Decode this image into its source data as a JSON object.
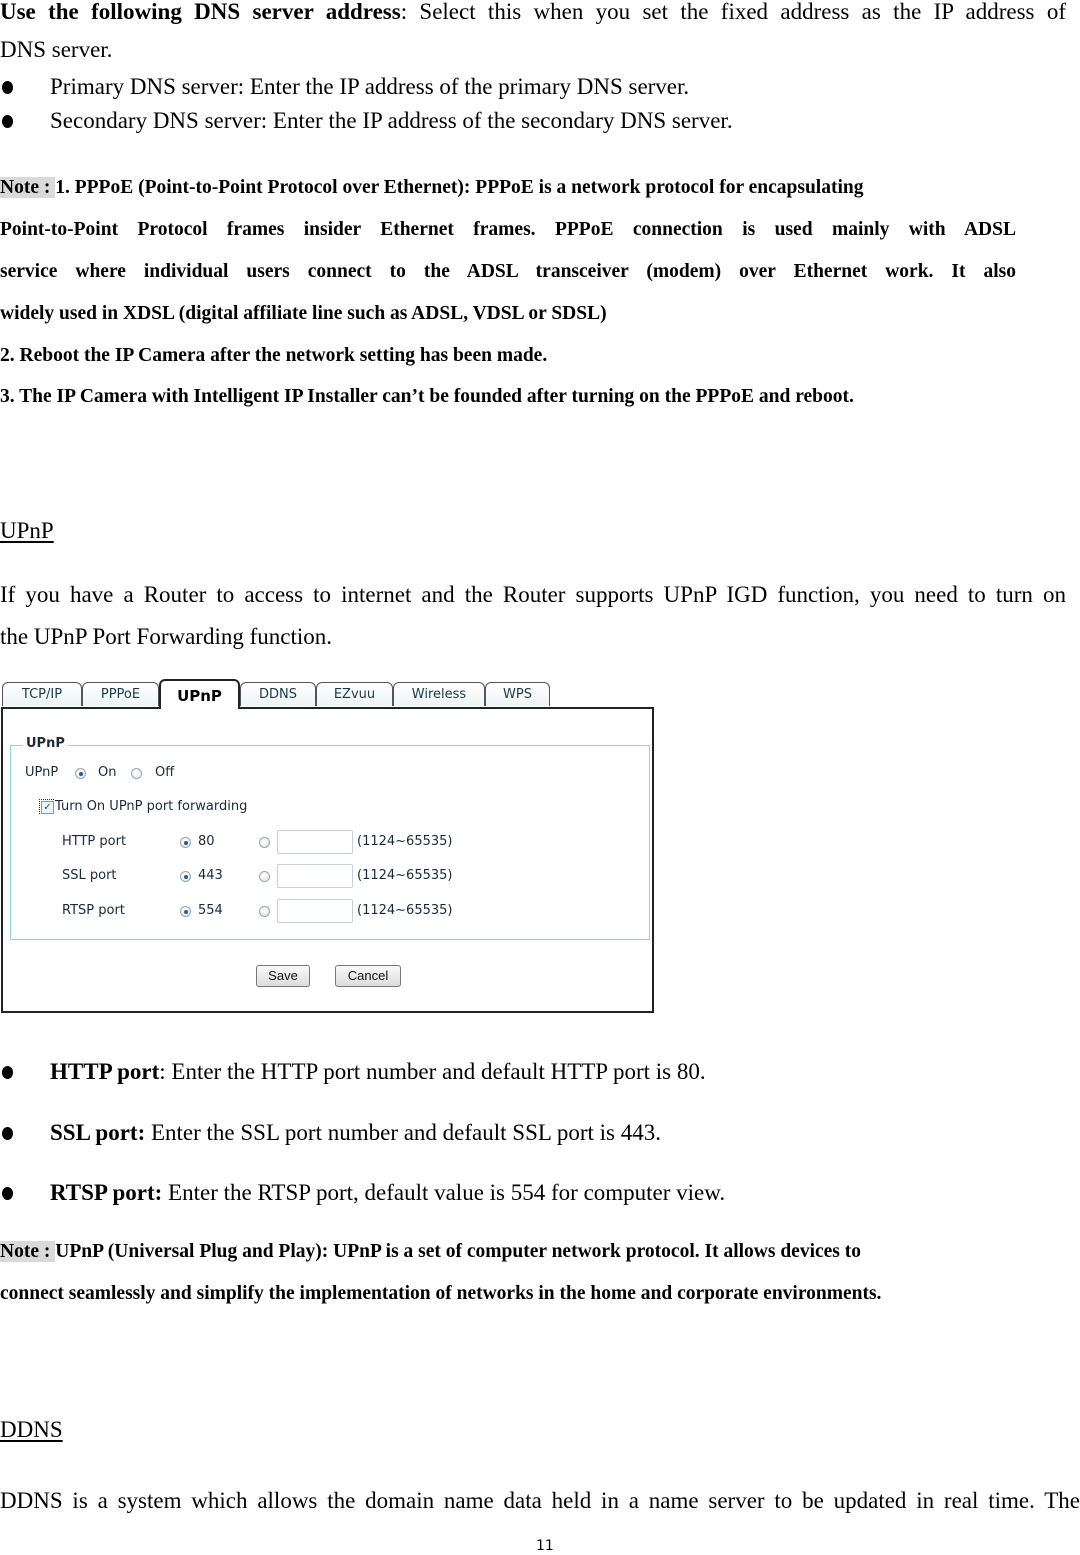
{
  "dns_section": {
    "intro_bold": "Use the following DNS server address",
    "intro_rest_line1": ": Select this when you set the fixed address as the IP address of",
    "intro_rest_line2": "DNS server.",
    "bullets": [
      "Primary DNS server: Enter the IP address of the primary DNS server.",
      "Secondary DNS server: Enter the IP address of the secondary DNS server."
    ]
  },
  "note_pppoe": {
    "tag": "Note : ",
    "lines": [
      "1. PPPoE (Point-to-Point Protocol over Ethernet): PPPoE is a network protocol for encapsulating",
      "Point-to-Point Protocol frames insider Ethernet frames. PPPoE connection is used mainly with ADSL",
      "service where individual users connect to the ADSL transceiver (modem) over Ethernet work. It also",
      "widely used in XDSL (digital affiliate line such as ADSL, VDSL or SDSL)",
      "2. Reboot the IP Camera after the network setting has been made.",
      "3. The IP Camera with Intelligent IP Installer can’t be founded after turning on the PPPoE and reboot."
    ]
  },
  "upnp_section": {
    "heading": "UPnP",
    "para_line1": "If you have a Router to access to internet and the Router supports UPnP IGD function, you need to turn on",
    "para_line2": "the UPnP Port Forwarding function."
  },
  "ui_screenshot": {
    "tabs": [
      {
        "label": "TCP/IP",
        "active": false
      },
      {
        "label": "PPPoE",
        "active": false
      },
      {
        "label": "UPnP",
        "active": true
      },
      {
        "label": "DDNS",
        "active": false
      },
      {
        "label": "EZvuu",
        "active": false
      },
      {
        "label": "Wireless",
        "active": false
      },
      {
        "label": "WPS",
        "active": false
      }
    ],
    "fieldset_legend": "UPnP",
    "upnp_label": "UPnP",
    "upnp_on_label": "On",
    "upnp_off_label": "Off",
    "upnp_selected": "On",
    "port_forwarding_label": "Turn On UPnP port forwarding",
    "port_forwarding_checked": true,
    "ports": [
      {
        "label": "HTTP port",
        "default": "80",
        "custom_value": "",
        "range": "(1124~65535)",
        "selected": "default"
      },
      {
        "label": "SSL port",
        "default": "443",
        "custom_value": "",
        "range": "(1124~65535)",
        "selected": "default"
      },
      {
        "label": "RTSP port",
        "default": "554",
        "custom_value": "",
        "range": "(1124~65535)",
        "selected": "default"
      }
    ],
    "save_label": "Save",
    "cancel_label": "Cancel"
  },
  "port_bullets": [
    {
      "bold": "HTTP port",
      "rest": ": Enter the HTTP port number and default HTTP port is 80."
    },
    {
      "bold": "SSL port:",
      "rest": " Enter the SSL port number and default SSL port is 443."
    },
    {
      "bold": "RTSP port:",
      "rest": " Enter the RTSP port, default value is 554 for computer view."
    }
  ],
  "note_upnp": {
    "tag": "Note : ",
    "line1": "UPnP (Universal Plug and Play): UPnP is a set of computer network protocol. It allows devices to",
    "line2": "connect seamlessly and simplify the implementation of networks in the home and corporate environments."
  },
  "ddns_section": {
    "heading": "DDNS",
    "para_line1": "DDNS is a system which allows the domain name data held in a name server to be updated in real time. The"
  },
  "page_number": "11"
}
